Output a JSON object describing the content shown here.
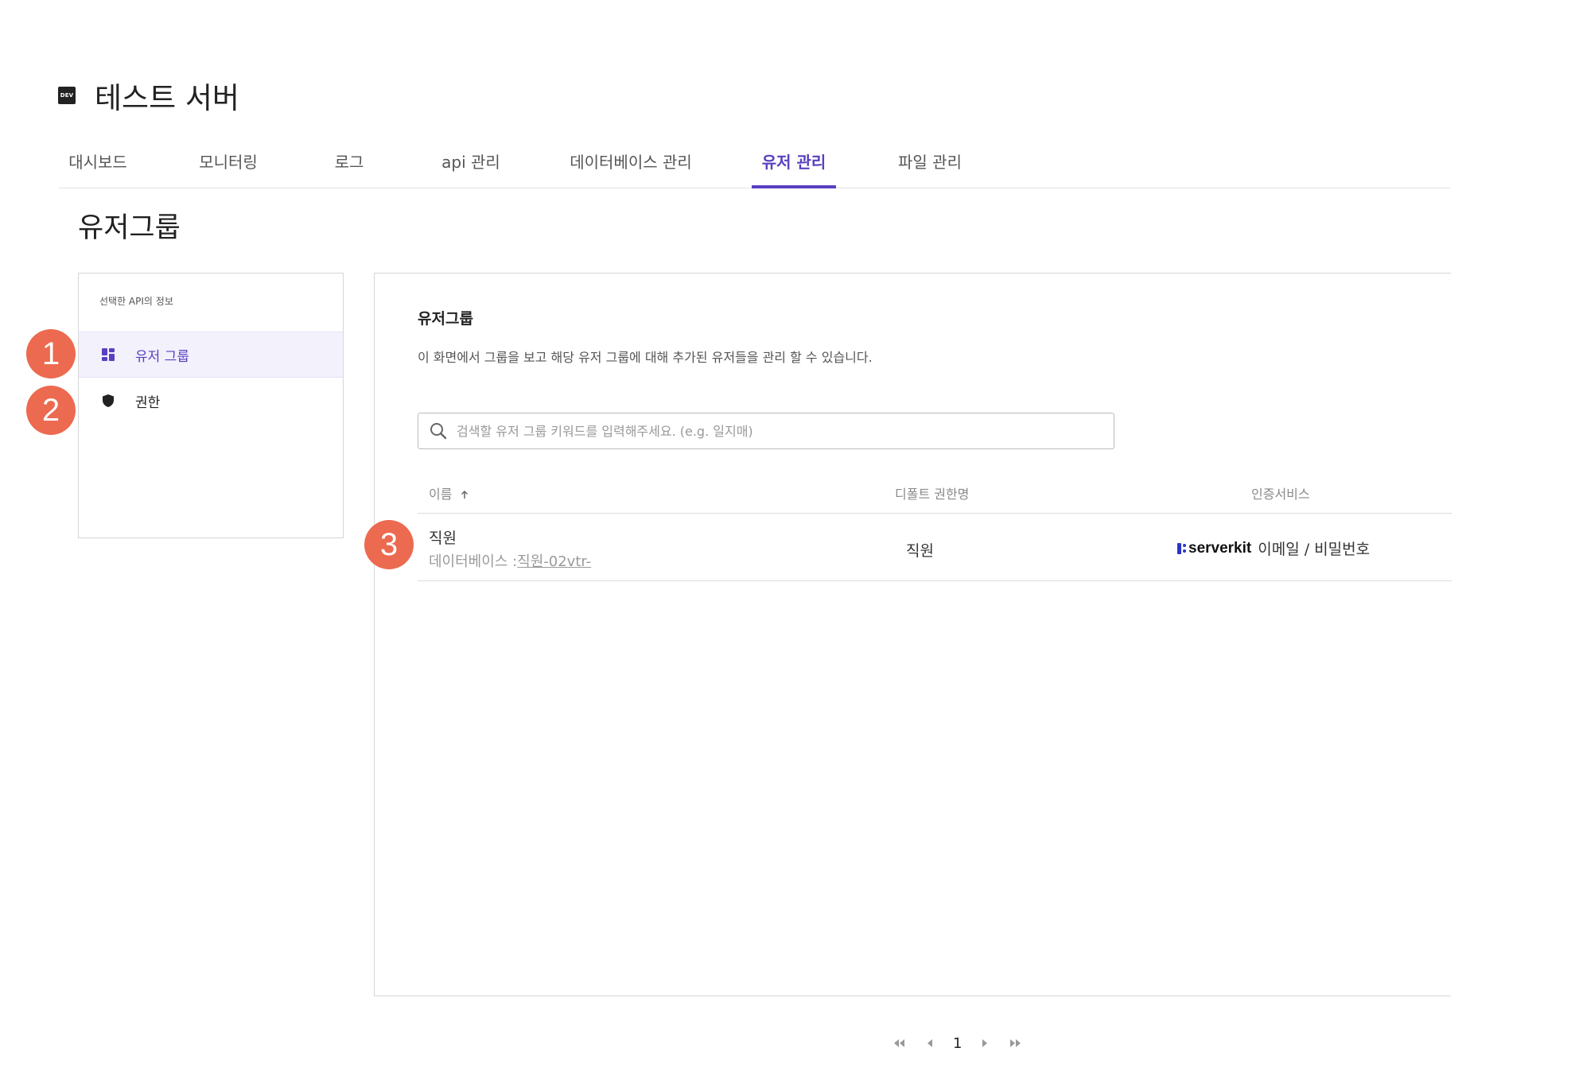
{
  "header": {
    "badge": "DEV",
    "server_name": "테스트 서버"
  },
  "tabs": [
    {
      "label": "대시보드"
    },
    {
      "label": "모니터링"
    },
    {
      "label": "로그"
    },
    {
      "label": "api 관리"
    },
    {
      "label": "데이터베이스 관리"
    },
    {
      "label": "유저 관리",
      "active": true
    },
    {
      "label": "파일 관리"
    }
  ],
  "page_title": "유저그룹",
  "sidebar": {
    "caption": "선택한 API의 정보",
    "items": [
      {
        "label": "유저 그룹",
        "icon": "dashboard-icon",
        "active": true
      },
      {
        "label": "권한",
        "icon": "shield-icon"
      }
    ]
  },
  "callouts": [
    "1",
    "2",
    "3"
  ],
  "panel": {
    "title": "유저그룹",
    "description": "이 화면에서 그룹을 보고 해당 유저 그룹에 대해 추가된 유저들을 관리 할 수 있습니다.",
    "search_placeholder": "검색할 유저 그룹 키워드를 입력해주세요. (e.g. 일지매)",
    "columns": {
      "name": "이름",
      "default_role": "디폴트 권한명",
      "auth_service": "인증서비스"
    },
    "rows": [
      {
        "name": "직원",
        "db_prefix": "데이터베이스 :",
        "db_link": "직원-02vtr-",
        "default_role": "직원",
        "auth_brand": "serverkit",
        "auth_method": "이메일 / 비밀번호"
      }
    ]
  },
  "pagination": {
    "current_page": "1"
  },
  "colors": {
    "accent": "#5a3fc0",
    "callout": "#ec6a50",
    "serverkit_brand": "#2a35c8"
  }
}
